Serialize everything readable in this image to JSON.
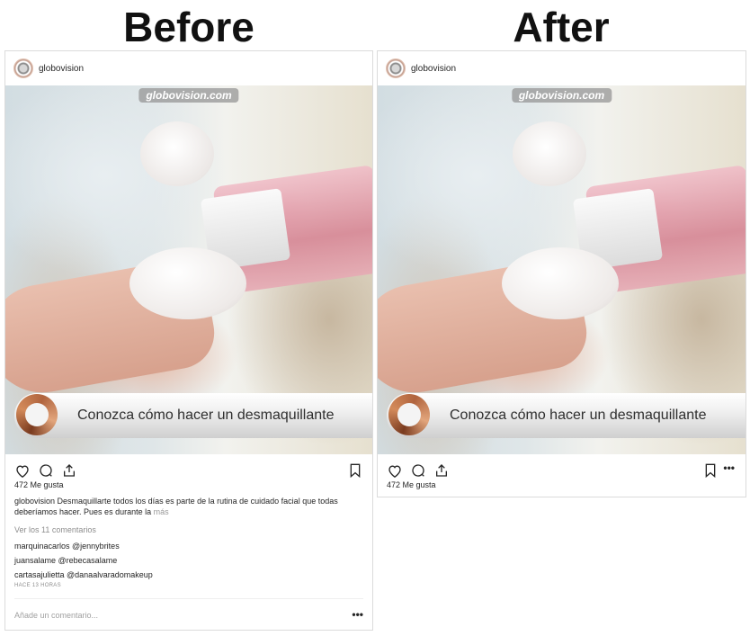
{
  "headings": {
    "before": "Before",
    "after": "After"
  },
  "post": {
    "username": "globovision",
    "watermark": "globovision.com",
    "banner_text": "Conozca cómo hacer un desmaquillante",
    "likes": "472 Me gusta"
  },
  "before": {
    "caption_user": "globovision",
    "caption_text": " Desmaquillarte todos los días es parte de la rutina de cuidado facial que todas deberíamos hacer. Pues es durante la",
    "caption_more": " más",
    "view_comments": "Ver los 11 comentarios",
    "comments": [
      {
        "user": "marquinacarlos",
        "text": " @jennybrites"
      },
      {
        "user": "juansalame",
        "text": " @rebecasalame"
      },
      {
        "user": "cartasajulietta",
        "text": " @danaalvaradomakeup"
      }
    ],
    "time": "HACE 13 HORAS",
    "add_comment_placeholder": "Añade un comentario...",
    "more_label": "•••"
  },
  "after": {
    "more_label": "•••"
  },
  "icons": [
    "heart-icon",
    "comment-icon",
    "share-icon",
    "bookmark-icon"
  ],
  "colors": {
    "text": "#262626",
    "muted": "#8e8e8e",
    "border": "#dbdbdb"
  }
}
